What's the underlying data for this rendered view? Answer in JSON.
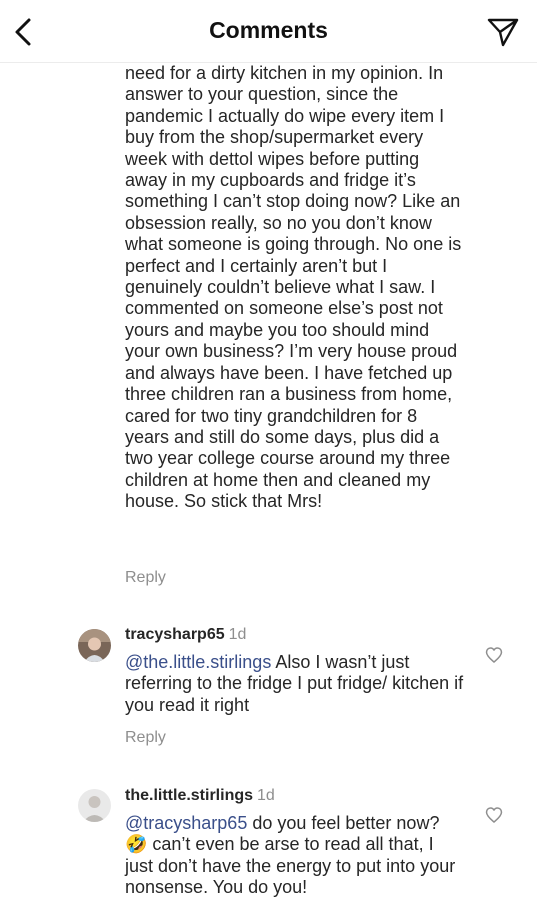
{
  "header": {
    "title": "Comments",
    "back_icon": "chevron-left-icon",
    "share_icon": "paper-plane-icon"
  },
  "comments": [
    {
      "text": "need for a dirty kitchen in my opinion. In answer to your question, since the pandemic I actually do wipe every item I buy from the shop/supermarket every week with dettol wipes before putting away in my cupboards and fridge it’s something I can’t stop doing now? Like an obsession really, so no you don’t know what someone is going through. No one is perfect and I certainly aren’t but I genuinely couldn’t believe what I saw. I commented on someone else’s post not yours and maybe you too should mind your own business? I’m very house proud and always have been. I have fetched up three children ran a business from home, cared for two tiny grandchildren for 8 years and still do some days, plus did a two year college course around my three children at home then and cleaned my house. So stick that Mrs!",
      "reply_label": "Reply"
    },
    {
      "username": "tracysharp65",
      "time": "1d",
      "mention": "@the.little.stirlings",
      "text": " Also I wasn’t just referring to the fridge I put fridge/ kitchen if you read it right",
      "reply_label": "Reply"
    },
    {
      "username": "the.little.stirlings",
      "time": "1d",
      "mention": "@tracysharp65",
      "text": " do you feel better now? 🤣 can’t even be arse to read all that, I just don’t have the energy to put into your nonsense. You do you!"
    }
  ],
  "colors": {
    "text": "#262626",
    "muted": "#8e8e8e",
    "mention": "#3a4f8a",
    "divider": "#ececec"
  }
}
